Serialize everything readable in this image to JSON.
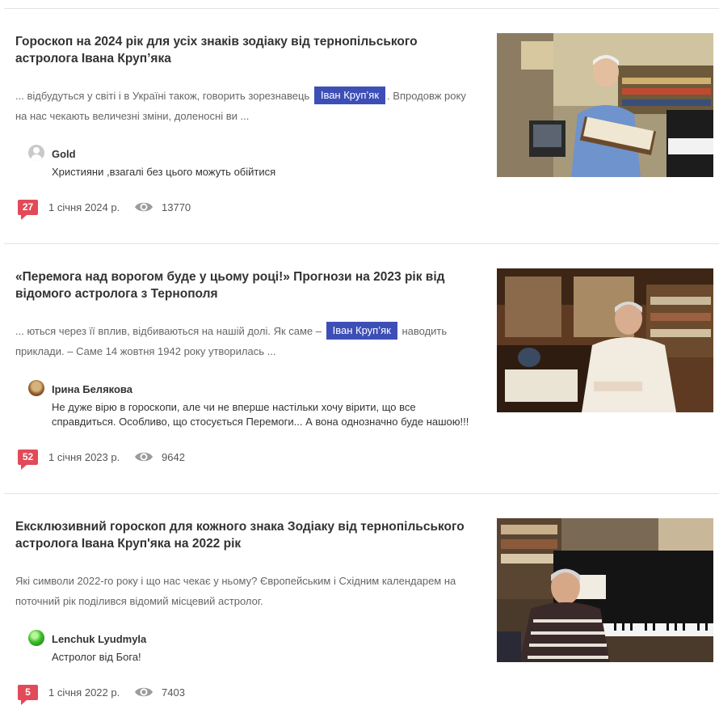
{
  "articles": [
    {
      "title": "Гороскоп на 2024 рік для усіх знаків зодіаку від тернопільського астролога Івана Круп’яка",
      "snippet_before": "... відбудуться у світі і в Україні також, говорить зорезнавець",
      "highlight": "Іван Круп’як",
      "snippet_after": ". Впродовж року на нас чекають величезні зміни, доленосні ви ...",
      "comment": {
        "author": "Gold",
        "text": "Християни ,взагалі без цього можуть обійтися",
        "avatar": "default-avatar-icon"
      },
      "comments_count": "27",
      "date": "1 січня 2024 р.",
      "views": "13770"
    },
    {
      "title": "«Перемога над ворогом буде у цьому році!» Прогнози на 2023 рік від відомого астролога з Тернополя",
      "snippet_before": "... ються через її вплив, відбиваються на нашій долі. Як саме –",
      "highlight": "Іван Круп’як",
      "snippet_after": "наводить приклади. – Саме 14 жовтня 1942 року утворилась ...",
      "comment": {
        "author": "Ірина Белякова",
        "text": "Не дуже вірю в гороскопи, але чи не вперше настільки хочу вірити, що все справдиться. Особливо, що стосується Перемоги... А вона однозначно буде нашою!!!",
        "avatar": "photo-avatar"
      },
      "comments_count": "52",
      "date": "1 січня 2023 р.",
      "views": "9642"
    },
    {
      "title": "Ексклюзивний гороскоп для кожного знака Зодіаку від тернопільського астролога Івана Круп'яка на 2022 рік",
      "snippet_before": "Які символи 2022-го року і що нас чекає у ньому? Європейським і Східним календарем на поточний рік поділився відомий місцевий астролог.",
      "highlight": "",
      "snippet_after": "",
      "comment": {
        "author": "Lenchuk Lyudmyla",
        "text": "Астролог від Бога!",
        "avatar": "photo-avatar"
      },
      "comments_count": "5",
      "date": "1 січня 2022 р.",
      "views": "7403"
    }
  ],
  "colors": {
    "badge": "#e24a57",
    "highlight": "#3d4fb6"
  },
  "icons": {
    "views": "eye-icon",
    "comments": "comment-badge-icon"
  }
}
